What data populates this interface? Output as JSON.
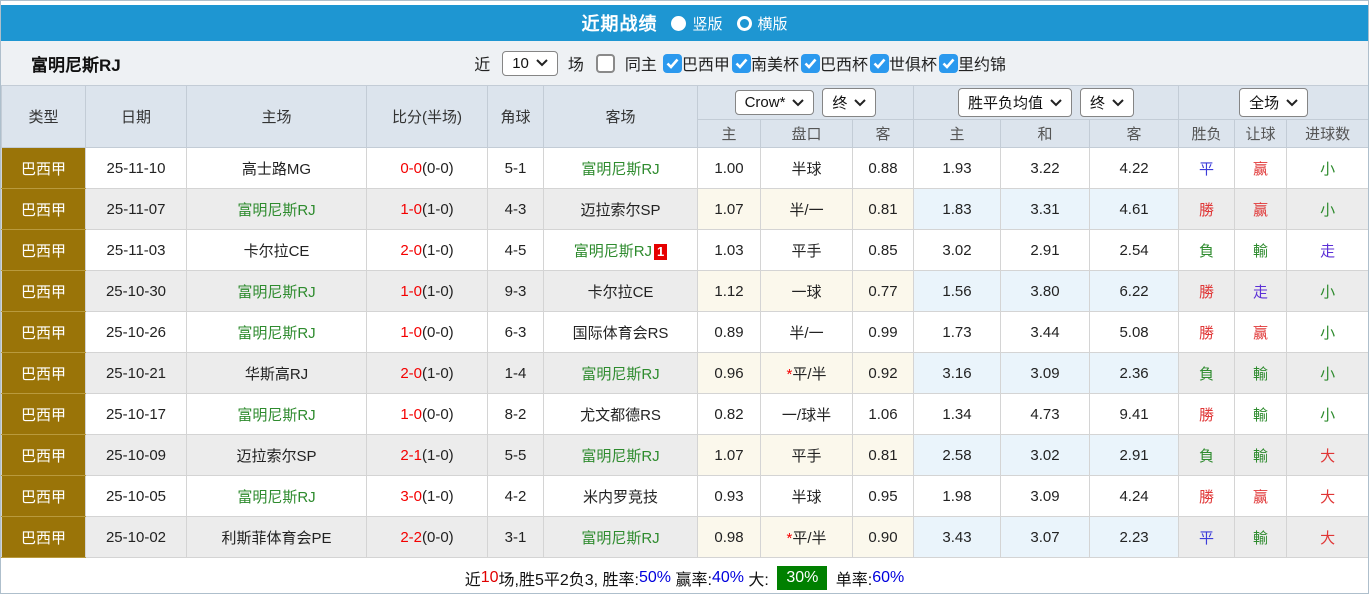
{
  "titlebar": {
    "title": "近期战绩",
    "radio_vertical": "竖版",
    "radio_horizontal": "横版"
  },
  "filterbar": {
    "team": "富明尼斯RJ",
    "recent_label": "近",
    "recent_value": "10",
    "games_label": "场",
    "same_home_label": "同主",
    "leagues": [
      {
        "label": "巴西甲",
        "checked": true
      },
      {
        "label": "南美杯",
        "checked": true
      },
      {
        "label": "巴西杯",
        "checked": true
      },
      {
        "label": "世俱杯",
        "checked": true
      },
      {
        "label": "里约锦",
        "checked": true
      }
    ]
  },
  "table": {
    "headers": [
      "类型",
      "日期",
      "主场",
      "比分(半场)",
      "角球",
      "客场"
    ],
    "dropdowns": {
      "bookmaker": "Crow*",
      "bookmaker_time": "终",
      "average": "胜平负均值",
      "average_time": "终",
      "scope": "全场"
    },
    "subheaders": [
      "主",
      "盘口",
      "客",
      "主",
      "和",
      "客",
      "胜负",
      "让球",
      "进球数"
    ],
    "rows": [
      {
        "league": "巴西甲",
        "date": "25-11-10",
        "home": "高士路MG",
        "home_cls": "",
        "score": "0-0",
        "half": "(0-0)",
        "corner": "5-1",
        "away": "富明尼斯RJ",
        "away_cls": "team-self",
        "badge": "",
        "ah_h": "1.00",
        "hc_star": "",
        "handicap": "半球",
        "ah_a": "0.88",
        "eu_h": "1.93",
        "eu_d": "3.22",
        "eu_a": "4.22",
        "wdl": "平",
        "wdl_cls": "c-blue",
        "hres": "赢",
        "hres_cls": "c-red",
        "ores": "小",
        "ores_cls": "c-green"
      },
      {
        "league": "巴西甲",
        "date": "25-11-07",
        "home": "富明尼斯RJ",
        "home_cls": "team-self",
        "score": "1-0",
        "half": "(1-0)",
        "corner": "4-3",
        "away": "迈拉索尔SP",
        "away_cls": "",
        "badge": "",
        "ah_h": "1.07",
        "hc_star": "",
        "handicap": "半/一",
        "ah_a": "0.81",
        "eu_h": "1.83",
        "eu_d": "3.31",
        "eu_a": "4.61",
        "wdl": "勝",
        "wdl_cls": "c-red",
        "hres": "赢",
        "hres_cls": "c-red",
        "ores": "小",
        "ores_cls": "c-green"
      },
      {
        "league": "巴西甲",
        "date": "25-11-03",
        "home": "卡尔拉CE",
        "home_cls": "",
        "score": "2-0",
        "half": "(1-0)",
        "corner": "4-5",
        "away": "富明尼斯RJ",
        "away_cls": "team-self",
        "badge": "1",
        "ah_h": "1.03",
        "hc_star": "",
        "handicap": "平手",
        "ah_a": "0.85",
        "eu_h": "3.02",
        "eu_d": "2.91",
        "eu_a": "2.54",
        "wdl": "負",
        "wdl_cls": "c-green",
        "hres": "輸",
        "hres_cls": "c-green",
        "ores": "走",
        "ores_cls": "c-purple"
      },
      {
        "league": "巴西甲",
        "date": "25-10-30",
        "home": "富明尼斯RJ",
        "home_cls": "team-self",
        "score": "1-0",
        "half": "(1-0)",
        "corner": "9-3",
        "away": "卡尔拉CE",
        "away_cls": "",
        "badge": "",
        "ah_h": "1.12",
        "hc_star": "",
        "handicap": "一球",
        "ah_a": "0.77",
        "eu_h": "1.56",
        "eu_d": "3.80",
        "eu_a": "6.22",
        "wdl": "勝",
        "wdl_cls": "c-red",
        "hres": "走",
        "hres_cls": "c-purple",
        "ores": "小",
        "ores_cls": "c-green"
      },
      {
        "league": "巴西甲",
        "date": "25-10-26",
        "home": "富明尼斯RJ",
        "home_cls": "team-self",
        "score": "1-0",
        "half": "(0-0)",
        "corner": "6-3",
        "away": "国际体育会RS",
        "away_cls": "",
        "badge": "",
        "ah_h": "0.89",
        "hc_star": "",
        "handicap": "半/一",
        "ah_a": "0.99",
        "eu_h": "1.73",
        "eu_d": "3.44",
        "eu_a": "5.08",
        "wdl": "勝",
        "wdl_cls": "c-red",
        "hres": "赢",
        "hres_cls": "c-red",
        "ores": "小",
        "ores_cls": "c-green"
      },
      {
        "league": "巴西甲",
        "date": "25-10-21",
        "home": "华斯高RJ",
        "home_cls": "",
        "score": "2-0",
        "half": "(1-0)",
        "corner": "1-4",
        "away": "富明尼斯RJ",
        "away_cls": "team-self",
        "badge": "",
        "ah_h": "0.96",
        "hc_star": "*",
        "handicap": "平/半",
        "ah_a": "0.92",
        "eu_h": "3.16",
        "eu_d": "3.09",
        "eu_a": "2.36",
        "wdl": "負",
        "wdl_cls": "c-green",
        "hres": "輸",
        "hres_cls": "c-green",
        "ores": "小",
        "ores_cls": "c-green"
      },
      {
        "league": "巴西甲",
        "date": "25-10-17",
        "home": "富明尼斯RJ",
        "home_cls": "team-self",
        "score": "1-0",
        "half": "(0-0)",
        "corner": "8-2",
        "away": "尤文都德RS",
        "away_cls": "",
        "badge": "",
        "ah_h": "0.82",
        "hc_star": "",
        "handicap": "一/球半",
        "ah_a": "1.06",
        "eu_h": "1.34",
        "eu_d": "4.73",
        "eu_a": "9.41",
        "wdl": "勝",
        "wdl_cls": "c-red",
        "hres": "輸",
        "hres_cls": "c-green",
        "ores": "小",
        "ores_cls": "c-green"
      },
      {
        "league": "巴西甲",
        "date": "25-10-09",
        "home": "迈拉索尔SP",
        "home_cls": "",
        "score": "2-1",
        "half": "(1-0)",
        "corner": "5-5",
        "away": "富明尼斯RJ",
        "away_cls": "team-self",
        "badge": "",
        "ah_h": "1.07",
        "hc_star": "",
        "handicap": "平手",
        "ah_a": "0.81",
        "eu_h": "2.58",
        "eu_d": "3.02",
        "eu_a": "2.91",
        "wdl": "負",
        "wdl_cls": "c-green",
        "hres": "輸",
        "hres_cls": "c-green",
        "ores": "大",
        "ores_cls": "c-red"
      },
      {
        "league": "巴西甲",
        "date": "25-10-05",
        "home": "富明尼斯RJ",
        "home_cls": "team-self",
        "score": "3-0",
        "half": "(1-0)",
        "corner": "4-2",
        "away": "米内罗竞技",
        "away_cls": "",
        "badge": "",
        "ah_h": "0.93",
        "hc_star": "",
        "handicap": "半球",
        "ah_a": "0.95",
        "eu_h": "1.98",
        "eu_d": "3.09",
        "eu_a": "4.24",
        "wdl": "勝",
        "wdl_cls": "c-red",
        "hres": "赢",
        "hres_cls": "c-red",
        "ores": "大",
        "ores_cls": "c-red"
      },
      {
        "league": "巴西甲",
        "date": "25-10-02",
        "home": "利斯菲体育会PE",
        "home_cls": "",
        "score": "2-2",
        "half": "(0-0)",
        "corner": "3-1",
        "away": "富明尼斯RJ",
        "away_cls": "team-self",
        "badge": "",
        "ah_h": "0.98",
        "hc_star": "*",
        "handicap": "平/半",
        "ah_a": "0.90",
        "eu_h": "3.43",
        "eu_d": "3.07",
        "eu_a": "2.23",
        "wdl": "平",
        "wdl_cls": "c-blue",
        "hres": "輸",
        "hres_cls": "c-green",
        "ores": "大",
        "ores_cls": "c-red"
      }
    ]
  },
  "summary": {
    "p1": "近",
    "p2": "10",
    "p3": "场,胜5平2负3, 胜率:",
    "p4": "50%",
    "p5": " 赢率:",
    "p6": "40%",
    "p7": " 大: ",
    "p8": "30%",
    "p9": " 单率:",
    "p10": "60%"
  },
  "colors": {
    "accent_blue": "#1e96d2",
    "league_gold": "#9a7408",
    "checkbox_blue": "#2b99ee",
    "win_red": "#e03636",
    "loss_green": "#2e8b2e",
    "draw_blue": "#3c3cd9",
    "push_purple": "#5b2fd6",
    "score_red": "#f40000",
    "summary_green": "#008000"
  }
}
